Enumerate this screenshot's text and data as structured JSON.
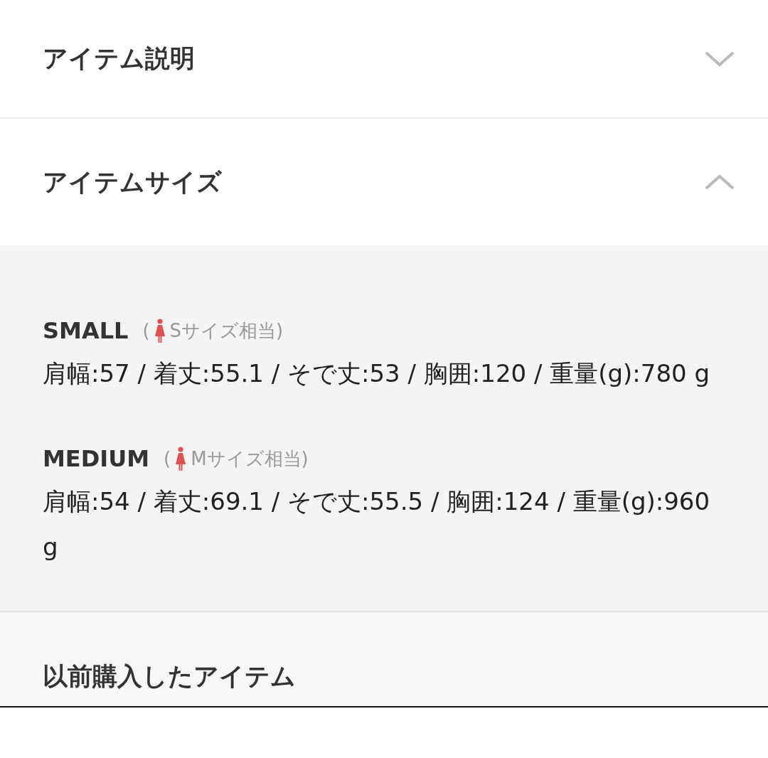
{
  "sections": [
    {
      "title": "アイテム説明",
      "expanded": false
    },
    {
      "title": "アイテムサイズ",
      "expanded": true
    }
  ],
  "sizes": [
    {
      "name": "SMALL",
      "open": "(",
      "equivalent": "Sサイズ相当)",
      "measurements": "肩幅:57 / 着丈:55.1 / そで丈:53 / 胸囲:120 / 重量(g):780 g"
    },
    {
      "name": "MEDIUM",
      "open": "(",
      "equivalent": "Mサイズ相当)",
      "measurements": "肩幅:54 / 着丈:69.1 / そで丈:55.5 / 胸囲:124 / 重量(g):960 g"
    }
  ],
  "previous_items": {
    "title": "以前購入したアイテム"
  }
}
